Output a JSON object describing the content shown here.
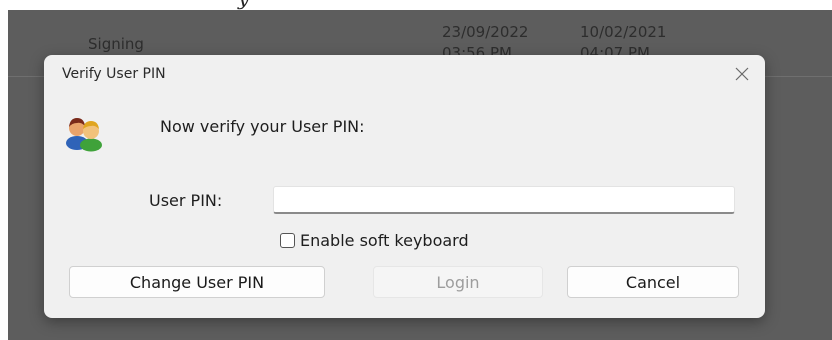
{
  "background": {
    "row_label": "Signing",
    "date_col1_line1": "23/09/2022",
    "date_col1_line2": "03:56 PM",
    "date_col2_line1": "10/02/2021",
    "date_col2_line2": "04:07 PM",
    "top_cut_text": "y"
  },
  "dialog": {
    "title": "Verify User PIN",
    "close_icon": "close-icon",
    "users_icon": "users-icon",
    "prompt": "Now verify your User PIN:",
    "pin_label": "User PIN:",
    "pin_value": "",
    "soft_keyboard_label": "Enable soft keyboard",
    "soft_keyboard_checked": false,
    "buttons": {
      "change_pin": "Change User PIN",
      "login": "Login",
      "cancel": "Cancel"
    },
    "login_enabled": false
  },
  "colors": {
    "backdrop": "#5d5d5d",
    "dialog_bg": "#f0f0f0",
    "disabled_text": "#9d9d9d"
  }
}
